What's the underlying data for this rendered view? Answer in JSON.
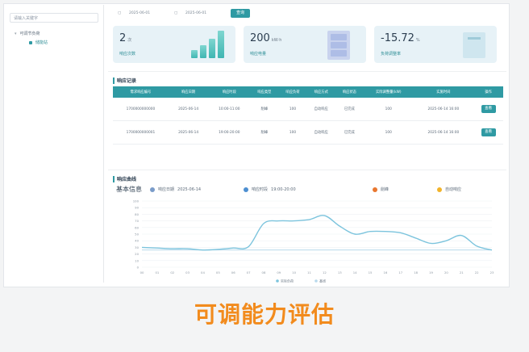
{
  "sidebar": {
    "search_placeholder": "请输入关键字",
    "tree_root": "可调节负荷",
    "tree_child": "储能站"
  },
  "filter": {
    "start_date": "2025-06-01",
    "end_date": "2025-06-01",
    "query_label": "查询"
  },
  "cards": [
    {
      "value": "2",
      "unit": "次",
      "label": "响应次数"
    },
    {
      "value": "200",
      "unit": "kW·h",
      "label": "响应电量"
    },
    {
      "value": "-15.72",
      "unit": "%",
      "label": "负荷调整率"
    }
  ],
  "records": {
    "title": "响应记录",
    "headers": [
      "需求响应编号",
      "响应日期",
      "响应时段",
      "响应类型",
      "响应负荷",
      "响应方式",
      "响应状态",
      "实际调整量(kW)",
      "实施时间",
      "操作"
    ],
    "rows": [
      [
        "1700000000000",
        "2025-06-14",
        "10:00-11:00",
        "削峰",
        "100",
        "自动响应",
        "已完成",
        "100",
        "2025-06-14 16:00",
        "查看"
      ],
      [
        "1700000000001",
        "2025-06-14",
        "19:00-20:00",
        "削峰",
        "100",
        "自动响应",
        "已完成",
        "100",
        "2025-06-14 16:00",
        "查看"
      ]
    ]
  },
  "curve": {
    "title": "响应曲线",
    "subtitle": "基本信息",
    "date_label": "响应日期",
    "date_value": "2025-06-14",
    "period_label": "响应时段",
    "period_value": "19:00-20:00",
    "tag1": "削峰",
    "tag2": "自动响应"
  },
  "chart_data": {
    "type": "line",
    "x": [
      "00",
      "01",
      "02",
      "03",
      "04",
      "05",
      "06",
      "07",
      "08",
      "09",
      "10",
      "11",
      "12",
      "13",
      "14",
      "15",
      "16",
      "17",
      "18",
      "19",
      "20",
      "21",
      "22",
      "23"
    ],
    "series": [
      {
        "name": "实际负荷",
        "values": [
          30,
          29,
          28,
          28,
          26,
          27,
          29,
          31,
          66,
          70,
          70,
          72,
          78,
          62,
          50,
          54,
          54,
          52,
          44,
          36,
          40,
          48,
          32,
          26
        ]
      },
      {
        "name": "基线",
        "values": [
          26,
          26,
          26,
          26,
          26,
          26,
          26,
          26,
          26,
          26,
          26,
          26,
          26,
          26,
          26,
          26,
          26,
          26,
          26,
          26,
          26,
          26,
          26,
          26
        ]
      }
    ],
    "ylim": [
      0,
      100
    ],
    "yticks": [
      "0",
      "10",
      "20",
      "30",
      "40",
      "50",
      "60",
      "70",
      "80",
      "90",
      "100"
    ],
    "colors": {
      "actual": "#7cc4dd",
      "baseline": "#b8d9ec"
    }
  },
  "caption": "可调能力评估"
}
